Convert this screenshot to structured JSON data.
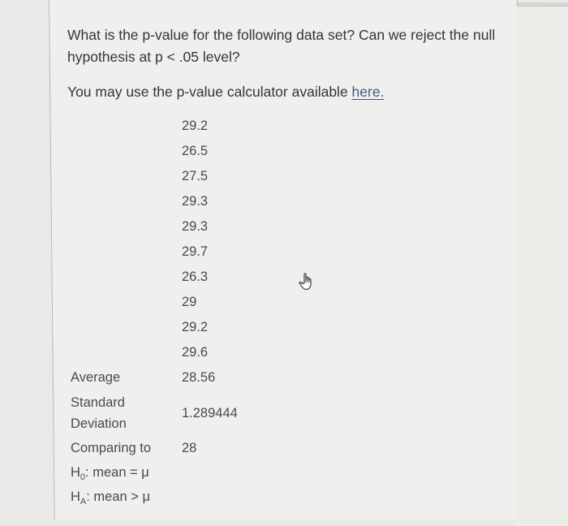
{
  "question": {
    "text": "What is the p-value for the following data set? Can we reject the null hypothesis at p < .05 level?",
    "calculator_prefix": "You may use the p-value calculator available ",
    "calculator_link": "here."
  },
  "data_set": {
    "values": [
      "29.2",
      "26.5",
      "27.5",
      "29.3",
      "29.3",
      "29.7",
      "26.3",
      "29",
      "29.2",
      "29.6"
    ]
  },
  "summary": {
    "average_label": "Average",
    "average_value": "28.56",
    "std_label_line1": "Standard",
    "std_label_line2": "Deviation",
    "std_value": "1.289444",
    "comparing_label": "Comparing to",
    "comparing_value": "28",
    "h0_main": "H",
    "h0_sub": "0",
    "h0_rest": ": mean = μ",
    "ha_main": "H",
    "ha_sub": "A",
    "ha_rest": ": mean > μ"
  },
  "icons": {
    "cursor": "hand-pointer-icon"
  },
  "colors": {
    "link": "#3d5a8a",
    "text": "#353535",
    "background": "#efefed"
  }
}
